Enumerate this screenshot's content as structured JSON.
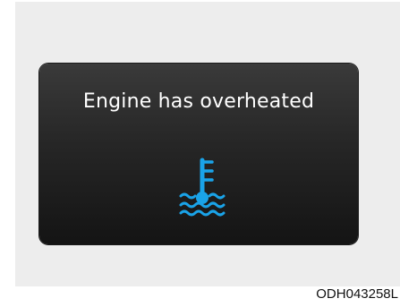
{
  "warning": {
    "message": "Engine has overheated",
    "icon": "coolant-temperature-icon",
    "icon_color": "#1aa3e8"
  },
  "figure_code": "ODH043258L",
  "colors": {
    "panel_background": "#ededed",
    "screen_background": "#1e1e1e",
    "text": "#ffffff"
  }
}
